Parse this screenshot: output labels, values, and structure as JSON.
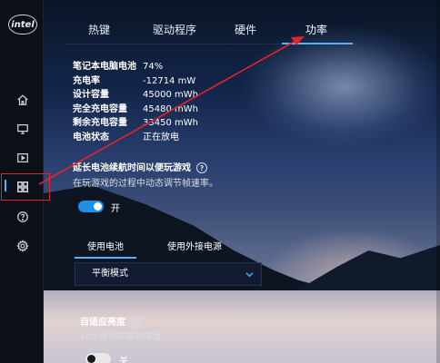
{
  "app": {
    "logo_text": "intel"
  },
  "tabs": [
    {
      "label": "热键"
    },
    {
      "label": "驱动程序"
    },
    {
      "label": "硬件"
    },
    {
      "label": "功率"
    }
  ],
  "battery": {
    "rows": [
      {
        "label": "笔记本电脑电池",
        "value": "74%"
      },
      {
        "label": "充电率",
        "value": "-12714 mW"
      },
      {
        "label": "设计容量",
        "value": "45000 mWh"
      },
      {
        "label": "完全充电容量",
        "value": "45480 mWh"
      },
      {
        "label": "剩余充电容量",
        "value": "33450 mWh"
      },
      {
        "label": "电池状态",
        "value": "正在放电"
      }
    ]
  },
  "extend_battery": {
    "title": "延长电池续航时间以便玩游戏",
    "desc": "在玩游戏的过程中动态调节帧速率。",
    "toggle_label": "开",
    "toggle_on": true
  },
  "power_source": {
    "tabs": [
      {
        "label": "使用电池"
      },
      {
        "label": "使用外接电源"
      }
    ],
    "selected_mode": "平衡模式"
  },
  "adaptive_brightness": {
    "title": "自适应亮度",
    "desc": "自动调节屏幕的亮度。",
    "toggle_label": "关",
    "toggle_on": false
  },
  "colors": {
    "accent": "#4fb3ff",
    "toggle_on": "#1e90e8",
    "annotation_red": "#e3242b"
  },
  "icons": {
    "sidebar": [
      "home-icon",
      "display-icon",
      "video-icon",
      "apps-grid-icon",
      "help-icon",
      "settings-gear-icon"
    ]
  }
}
